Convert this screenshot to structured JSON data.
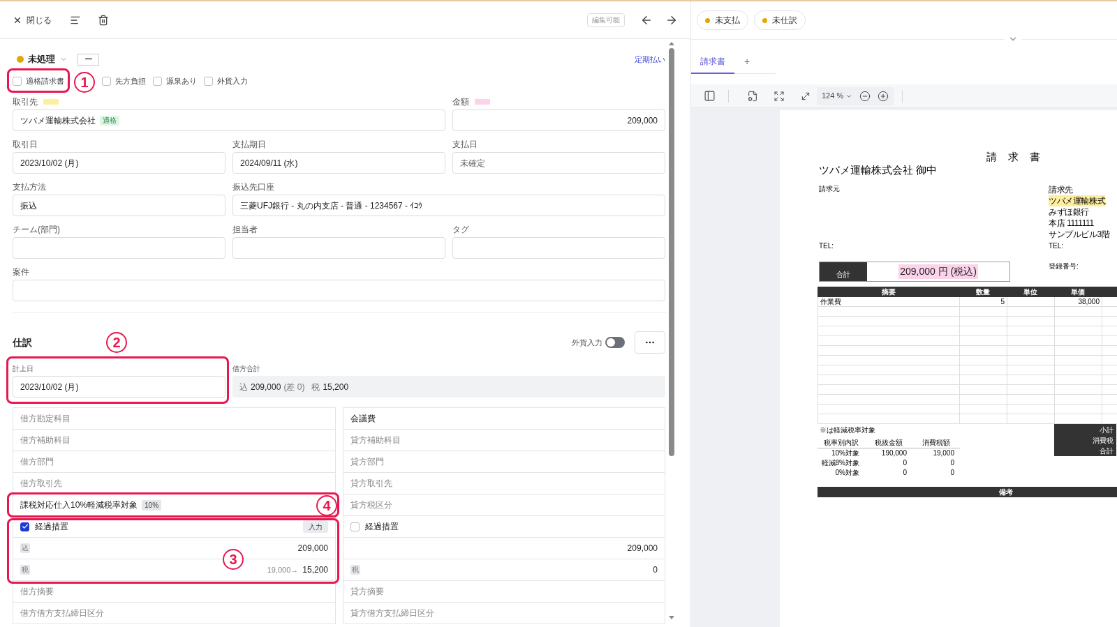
{
  "toolbar": {
    "close": "閉じる",
    "edit_status": "編集可能"
  },
  "status": {
    "label": "未処理",
    "color": "#e6a700",
    "mode": "ー",
    "link": "定期払い"
  },
  "flags": [
    {
      "label": "適格請求書",
      "checked": false,
      "highlighted": true,
      "callout": "1"
    },
    {
      "label": "先方負担",
      "checked": false,
      "highlighted": false
    },
    {
      "label": "源泉あり",
      "checked": false,
      "highlighted": false
    },
    {
      "label": "外貨入力",
      "checked": false,
      "highlighted": false
    }
  ],
  "fields": [
    {
      "label": "取引先",
      "color": "#fdeea0",
      "value": "ツバメ運輸株式会社",
      "badge": "適格",
      "kind": "text"
    },
    {
      "label": "金額",
      "color": "#fcd3ea",
      "value": "209,000",
      "kind": "amount"
    },
    {
      "label": "取引日",
      "value": "2023/10/02 (月)",
      "kind": "text"
    },
    {
      "label": "支払期日",
      "value": "2024/09/11 (水)",
      "kind": "text"
    },
    {
      "label": "支払日",
      "placeholder": "未確定",
      "kind": "text"
    },
    {
      "label": "支払方法",
      "value": "振込",
      "kind": "text"
    },
    {
      "label": "振込先口座",
      "value": "三菱UFJ銀行 - 丸の内支店 - 普通 - 1234567 - ｲｺｳ",
      "kind": "text"
    },
    {
      "label": "チーム(部門)",
      "kind": "text"
    },
    {
      "label": "担当者",
      "kind": "text"
    },
    {
      "label": "タグ",
      "kind": "text"
    },
    {
      "label": "案件",
      "kind": "text"
    }
  ],
  "journal": {
    "title": "仕訳",
    "fx_label": "外貨入力",
    "fx_on": false,
    "date": {
      "label": "計上日",
      "value": "2023/10/02 (月)",
      "highlighted": true,
      "callout": "2"
    },
    "total": {
      "label": "借方合計",
      "incl": "込",
      "amount": "209,000",
      "diff": "(差 0)",
      "tax_label": "税",
      "tax": "15,200"
    },
    "debit": [
      {
        "kind": "field",
        "placeholder": "借方勘定科目"
      },
      {
        "kind": "field",
        "placeholder": "借方補助科目"
      },
      {
        "kind": "field",
        "placeholder": "借方部門"
      },
      {
        "kind": "field",
        "placeholder": "借方取引先"
      },
      {
        "kind": "tax",
        "value": "課税対応仕入10%軽減税率対象",
        "badge": "10%",
        "highlighted": true,
        "callout": "4"
      },
      {
        "kind": "group",
        "highlighted": true,
        "callout": "3",
        "children": [
          {
            "kind": "check",
            "label": "経過措置",
            "checked": true,
            "button": "入力"
          },
          {
            "kind": "amount",
            "badge": "込",
            "value": "209,000"
          },
          {
            "kind": "amount",
            "badge": "税",
            "previous": "19,000→",
            "value": "15,200"
          }
        ]
      },
      {
        "kind": "field",
        "placeholder": "借方摘要"
      },
      {
        "kind": "field",
        "placeholder": "借方借方支払締日区分"
      }
    ],
    "credit": [
      {
        "kind": "field",
        "value": "会議費"
      },
      {
        "kind": "field",
        "placeholder": "貸方補助科目"
      },
      {
        "kind": "field",
        "placeholder": "貸方部門"
      },
      {
        "kind": "field",
        "placeholder": "貸方取引先"
      },
      {
        "kind": "field",
        "placeholder": "貸方税区分"
      },
      {
        "kind": "check",
        "label": "経過措置",
        "checked": false
      },
      {
        "kind": "amount",
        "value": "209,000"
      },
      {
        "kind": "amount",
        "badge": "税",
        "value": "0"
      },
      {
        "kind": "field",
        "placeholder": "貸方摘要"
      },
      {
        "kind": "field",
        "placeholder": "貸方借方支払締日区分"
      }
    ]
  },
  "statuses": [
    {
      "label": "未支払",
      "color": "#e6a700"
    },
    {
      "label": "未仕訳",
      "color": "#e6a700"
    }
  ],
  "doc_tabs": [
    {
      "label": "請求書",
      "selected": true
    }
  ],
  "add_tab": "+",
  "viewer": {
    "zoom": "124 %"
  },
  "invoice": {
    "title": "請 求 書",
    "recipient": "ツバメ運輸株式会社 御中",
    "issuer_label": "請求元",
    "issuer_tel": "TEL:",
    "billing": [
      {
        "text": "請求先",
        "highlighted": false
      },
      {
        "text": "ツバメ運輸株式",
        "highlighted": true
      },
      {
        "text": "みずほ銀行",
        "highlighted": false
      },
      {
        "text": "本店 1111111",
        "highlighted": false
      },
      {
        "text": "サンプルビル3階",
        "highlighted": false
      }
    ],
    "billing_tel": "TEL:",
    "registration": "登録番号:",
    "total_label": "合計",
    "total": "209,000 円 (税込)",
    "columns": [
      "摘要",
      "数量",
      "単位",
      "単価"
    ],
    "rows": [
      [
        "作業費",
        "5",
        "",
        "38,000"
      ]
    ],
    "note": "※は軽減税率対象",
    "tax_columns": [
      "税率別内訳",
      "税抜金額",
      "消費税額"
    ],
    "tax_rows": [
      [
        "10%対象",
        "190,000",
        "19,000"
      ],
      [
        "軽減8%対象",
        "0",
        "0"
      ],
      [
        "0%対象",
        "0",
        "0"
      ]
    ],
    "summary": [
      "小計",
      "消費税",
      "合計"
    ],
    "remarks": "備考"
  }
}
